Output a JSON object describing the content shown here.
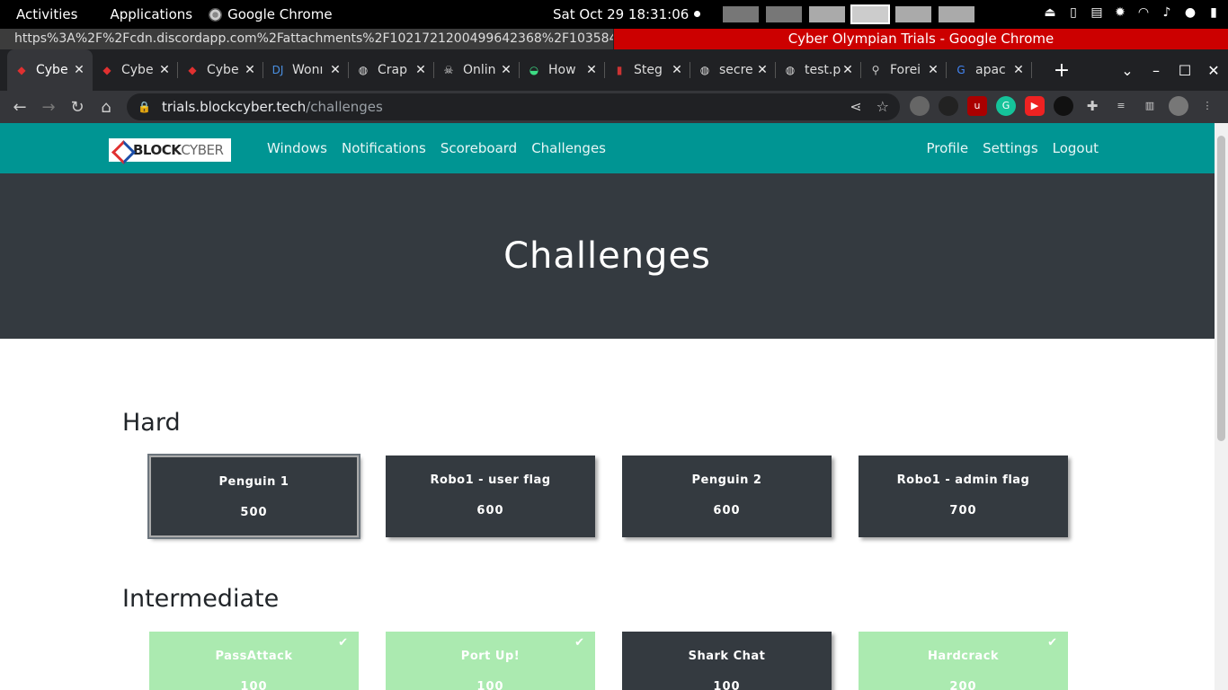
{
  "os_topbar": {
    "activities": "Activities",
    "applications": "Applications",
    "app_name": "Google Chrome",
    "clock": "Sat Oct 29  18:31:06"
  },
  "window": {
    "url_tooltip": "https%3A%2F%2Fcdn.discordapp.com%2Fattachments%2F1021721200499642368%2F1035847...",
    "title": "Cyber Olympian Trials - Google Chrome"
  },
  "tabs": [
    {
      "label": "Cybe",
      "icon": "blockcyber-favicon",
      "active": true
    },
    {
      "label": "Cybe",
      "icon": "blockcyber-favicon",
      "active": false
    },
    {
      "label": "Cybe",
      "icon": "blockcyber-favicon",
      "active": false
    },
    {
      "label": "Wonı",
      "icon": "dj-favicon",
      "active": false
    },
    {
      "label": "Crap",
      "icon": "globe-icon",
      "active": false
    },
    {
      "label": "Onlin",
      "icon": "skull-icon",
      "active": false
    },
    {
      "label": "How",
      "icon": "android-icon",
      "active": false
    },
    {
      "label": "Steg",
      "icon": "steg-favicon",
      "active": false
    },
    {
      "label": "secre",
      "icon": "globe-icon",
      "active": false
    },
    {
      "label": "test.p",
      "icon": "globe-icon",
      "active": false
    },
    {
      "label": "Forei",
      "icon": "search-icon",
      "active": false
    },
    {
      "label": "apac",
      "icon": "google-icon",
      "active": false
    }
  ],
  "omnibox": {
    "host": "trials.blockcyber.tech",
    "path": "/challenges"
  },
  "site": {
    "logo_text_bold": "BLOCK",
    "logo_text_light": "CYBER",
    "nav_left": [
      "Windows",
      "Notifications",
      "Scoreboard",
      "Challenges"
    ],
    "nav_right": [
      "Profile",
      "Settings",
      "Logout"
    ],
    "heading": "Challenges"
  },
  "categories": [
    {
      "name": "Hard",
      "challenges": [
        {
          "name": "Penguin 1",
          "value": "500",
          "solved": false,
          "selected": true
        },
        {
          "name": "Robo1 - user flag",
          "value": "600",
          "solved": false,
          "selected": false
        },
        {
          "name": "Penguin 2",
          "value": "600",
          "solved": false,
          "selected": false
        },
        {
          "name": "Robo1 - admin flag",
          "value": "700",
          "solved": false,
          "selected": false
        }
      ]
    },
    {
      "name": "Intermediate",
      "challenges": [
        {
          "name": "PassAttack",
          "value": "100",
          "solved": true,
          "selected": false
        },
        {
          "name": "Port Up!",
          "value": "100",
          "solved": true,
          "selected": false
        },
        {
          "name": "Shark Chat",
          "value": "100",
          "solved": false,
          "selected": false
        },
        {
          "name": "Hardcrack",
          "value": "200",
          "solved": true,
          "selected": false
        }
      ]
    }
  ],
  "colors": {
    "nav_bg": "#009593",
    "jumbotron_bg": "#343a40",
    "card_bg": "#343a40",
    "solved_bg": "#abeab0",
    "title_bar_red": "#cc0000"
  }
}
